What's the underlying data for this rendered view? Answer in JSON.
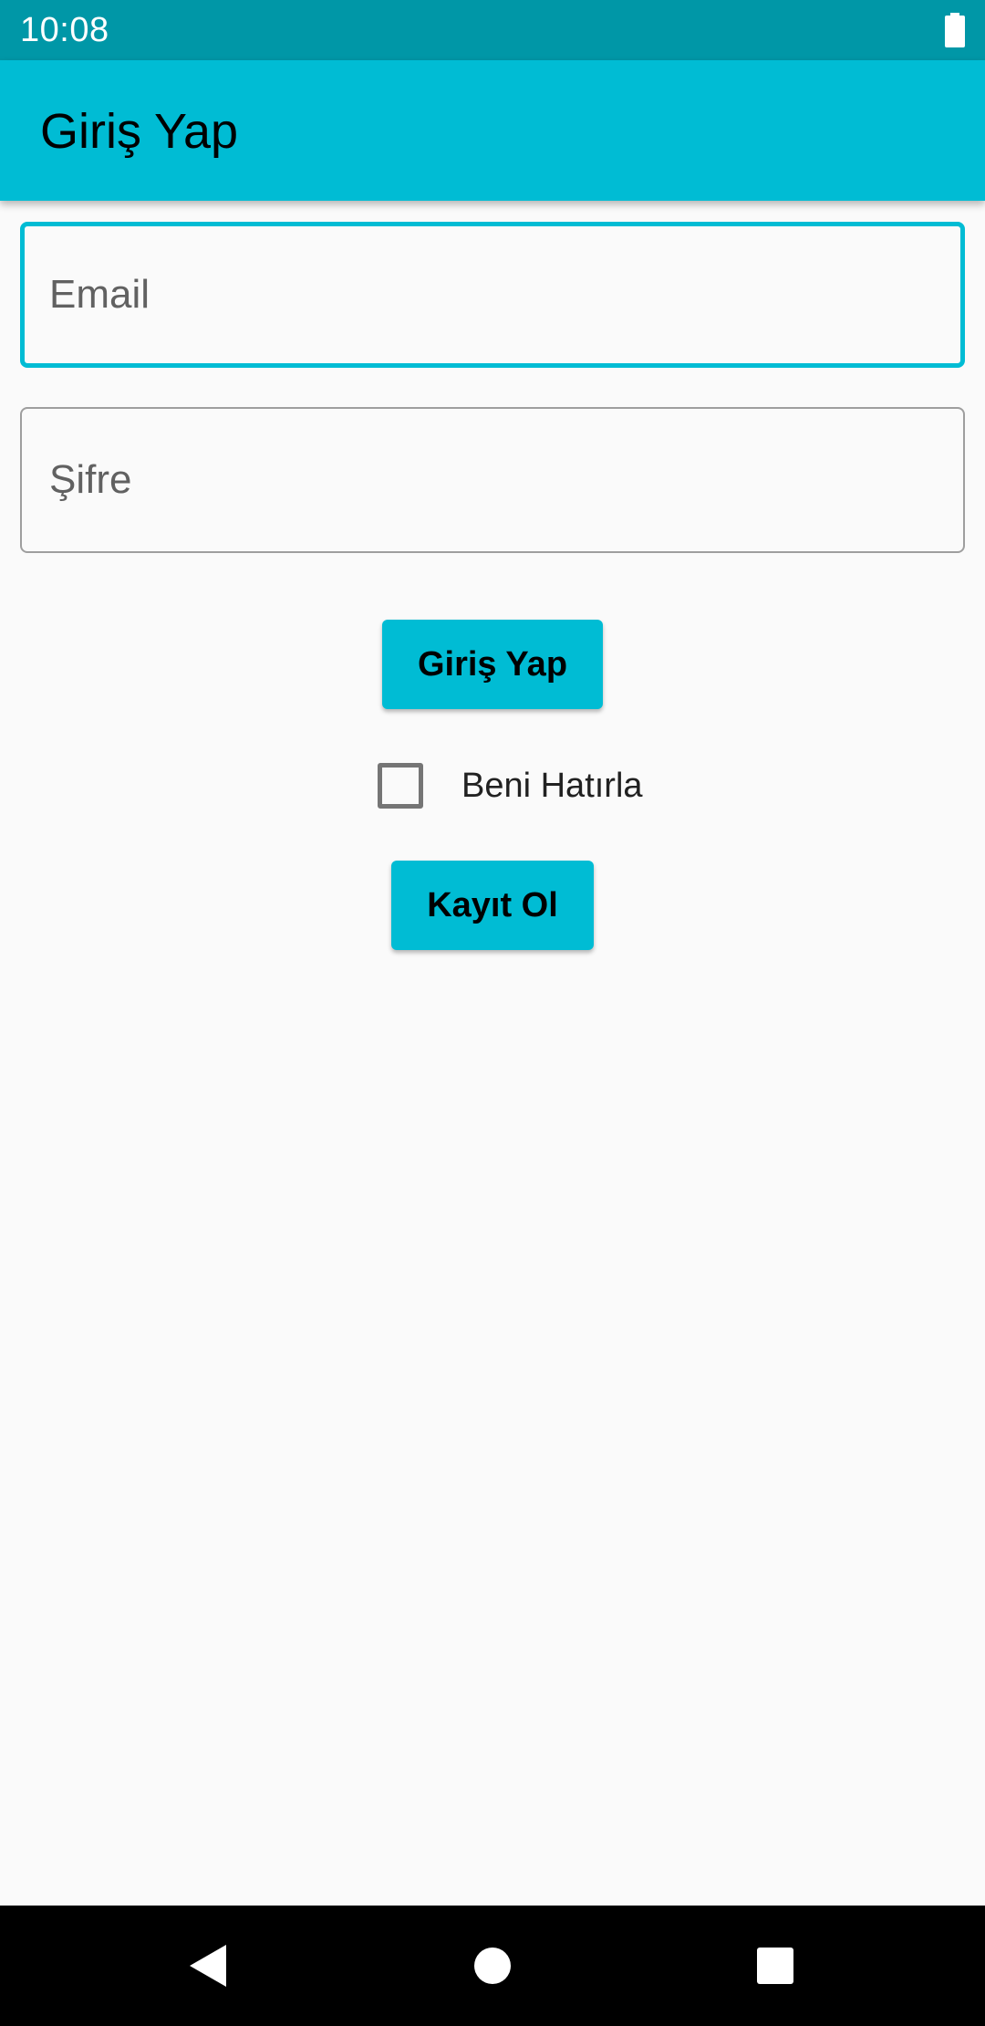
{
  "status_bar": {
    "time": "10:08",
    "battery_icon": "battery-full-icon"
  },
  "app_bar": {
    "title": "Giriş Yap"
  },
  "form": {
    "email_placeholder": "Email",
    "email_value": "",
    "password_placeholder": "Şifre",
    "password_value": "",
    "login_button_label": "Giriş Yap",
    "remember_me_label": "Beni Hatırla",
    "remember_me_checked": false,
    "register_button_label": "Kayıt Ol"
  },
  "nav_bar": {
    "back_icon": "triangle-back-icon",
    "home_icon": "circle-home-icon",
    "recents_icon": "square-recents-icon"
  },
  "colors": {
    "status_bar": "#0097A7",
    "accent": "#00BCD4",
    "background": "#FAFAFA",
    "nav_bar": "#000000"
  }
}
